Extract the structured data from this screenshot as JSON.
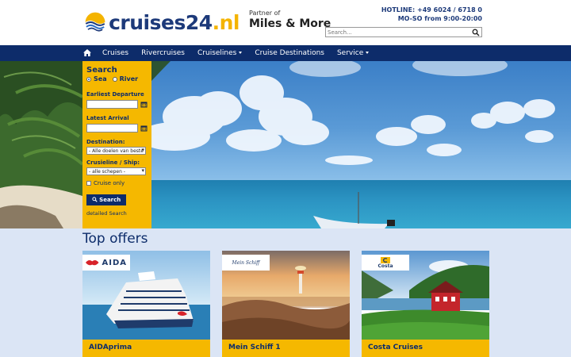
{
  "brand": {
    "name": "cruises24",
    "tld": ".nl",
    "partner_small": "Partner of",
    "partner_big": "Miles & More"
  },
  "hotline": {
    "line1": "HOTLINE: +49 6024 / 6718 0",
    "line2": "MO-SO from 9:00-20:00"
  },
  "search": {
    "placeholder": "Search..."
  },
  "nav": {
    "items": [
      {
        "label": "Cruises"
      },
      {
        "label": "Rivercruises"
      },
      {
        "label": "Cruiselines"
      },
      {
        "label": "Cruise Destinations"
      },
      {
        "label": "Service"
      }
    ]
  },
  "search_panel": {
    "title": "Search",
    "radio_sea": "Sea",
    "radio_river": "River",
    "earliest_label": "Earliest Departure",
    "latest_label": "Latest Arrival",
    "destination_label": "Destination:",
    "destination_value": "- Alle doelen van beste",
    "cruiseline_label": "Crusieline / Ship:",
    "cruiseline_value": "- alle schepen -",
    "cruise_only": "Cruise only",
    "button": "Search",
    "detailed": "detailed Search"
  },
  "offers": {
    "title": "Top offers",
    "items": [
      {
        "name": "AIDAprima",
        "brand": "AIDA"
      },
      {
        "name": "Mein Schiff 1",
        "brand": "Mein Schiff"
      },
      {
        "name": "Costa Cruises",
        "brand": "Costa"
      }
    ]
  },
  "colors": {
    "navy": "#0d2c6a",
    "accent_yellow": "#f5b800"
  }
}
